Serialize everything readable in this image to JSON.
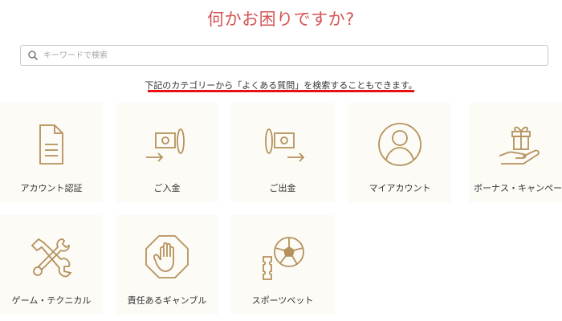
{
  "header": {
    "title": "何かお困りですか?"
  },
  "search": {
    "placeholder": "キーワードで検索"
  },
  "hint": {
    "text": "下記のカテゴリーから「よくある質問」を検索することもできます。"
  },
  "categories": [
    {
      "label": "アカウント認証",
      "icon": "document-icon"
    },
    {
      "label": "ご入金",
      "icon": "deposit-icon"
    },
    {
      "label": "ご出金",
      "icon": "withdrawal-icon"
    },
    {
      "label": "マイアカウント",
      "icon": "user-icon"
    },
    {
      "label": "ボーナス・キャンペーン",
      "icon": "gift-hand-icon"
    },
    {
      "label": "ゲーム・テクニカル",
      "icon": "tools-icon"
    },
    {
      "label": "責任あるギャンブル",
      "icon": "stop-hand-icon"
    },
    {
      "label": "スポーツベット",
      "icon": "sports-ticket-icon"
    }
  ],
  "colors": {
    "accent": "#d65555",
    "icon": "#b5915c",
    "card_bg": "#fdfbf6",
    "highlight": "#e81010"
  }
}
